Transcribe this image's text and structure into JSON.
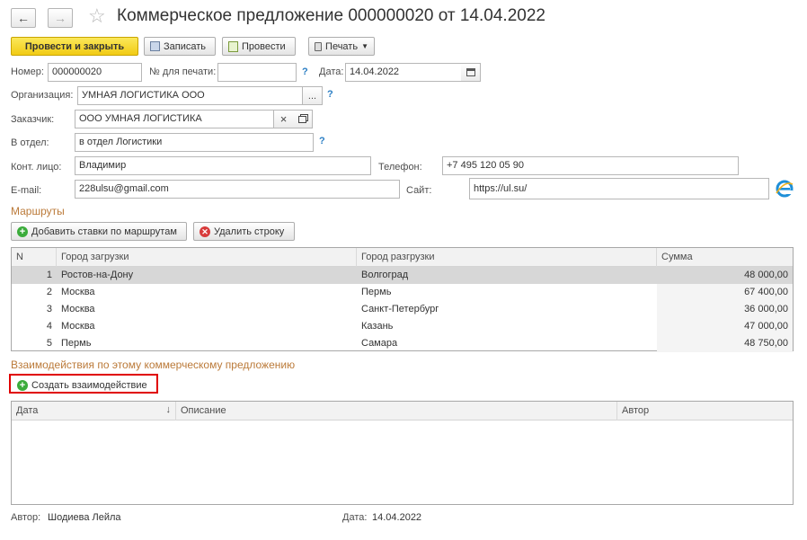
{
  "window": {
    "title": "Коммерческое предложение 000000020 от 14.04.2022",
    "back_icon": "←",
    "forward_icon": "→",
    "favorite_icon": "☆"
  },
  "toolbar": {
    "post_and_close": "Провести и закрыть",
    "save": "Записать",
    "post": "Провести",
    "print": "Печать"
  },
  "form": {
    "number_label": "Номер:",
    "number_value": "000000020",
    "print_number_label": "№ для печати:",
    "print_number_value": "",
    "date_label": "Дата:",
    "date_value": "14.04.2022",
    "org_label": "Организация:",
    "org_value": "УМНАЯ ЛОГИСТИКА ООО",
    "customer_label": "Заказчик:",
    "customer_value": "ООО УМНАЯ ЛОГИСТИКА",
    "dept_label": "В отдел:",
    "dept_value": "в отдел Логистики",
    "contact_label": "Конт. лицо:",
    "contact_value": "Владимир",
    "phone_label": "Телефон:",
    "phone_value": "+7 495 120 05 90",
    "email_label": "E-mail:",
    "email_value": "228ulsu@gmail.com",
    "site_label": "Сайт:",
    "site_value": "https://ul.su/",
    "help_mark": "?",
    "ellipsis": "...",
    "clear_mark": "×"
  },
  "routes": {
    "section_title": "Маршруты",
    "add_rates_button": "Добавить ставки по маршрутам",
    "delete_row_button": "Удалить строку",
    "columns": [
      "N",
      "Город загрузки",
      "Город разгрузки",
      "Сумма"
    ],
    "rows": [
      {
        "n": "1",
        "from": "Ростов-на-Дону",
        "to": "Волгоград",
        "sum": "48 000,00"
      },
      {
        "n": "2",
        "from": "Москва",
        "to": "Пермь",
        "sum": "67 400,00"
      },
      {
        "n": "3",
        "from": "Москва",
        "to": "Санкт-Петербург",
        "sum": "36 000,00"
      },
      {
        "n": "4",
        "from": "Москва",
        "to": "Казань",
        "sum": "47 000,00"
      },
      {
        "n": "5",
        "from": "Пермь",
        "to": "Самара",
        "sum": "48 750,00"
      }
    ]
  },
  "interactions": {
    "section_title": "Взаимодействия по этому коммерческому предложению",
    "create_button": "Создать взаимодействие",
    "columns": [
      "Дата",
      "Описание",
      "Автор"
    ],
    "sort_icon": "↓"
  },
  "footer": {
    "author_label": "Автор:",
    "author_value": "Шодиева Лейла",
    "date_label": "Дата:",
    "date_value": "14.04.2022"
  },
  "colors": {
    "primary_button": "#f1cb14",
    "section_title": "#bb7a39",
    "highlight_border": "#e00000",
    "help_mark": "#2a7ec4"
  }
}
